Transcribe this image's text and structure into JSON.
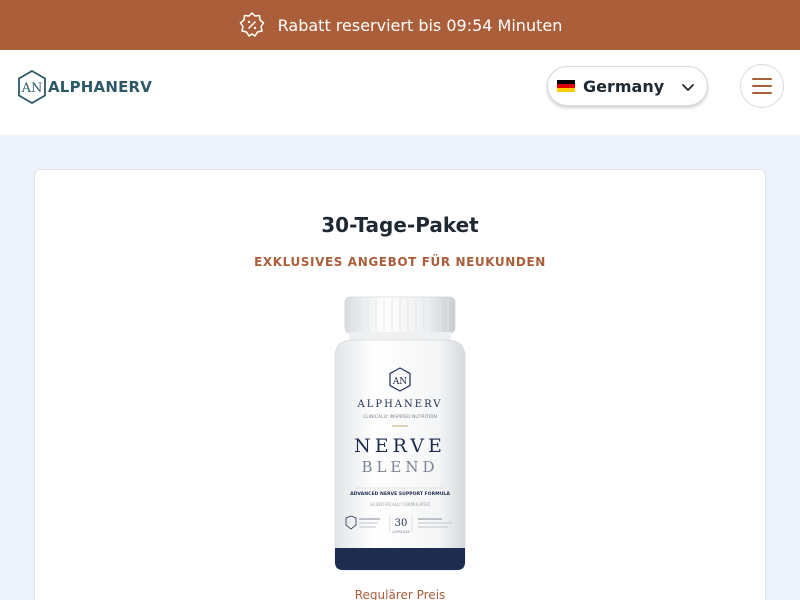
{
  "promo": {
    "text": "Rabatt reserviert bis 09:54 Minuten",
    "icon": "discount-badge-icon",
    "background": "#aa5e3a"
  },
  "header": {
    "logo_text": "ALPHANERV",
    "logo_mark": "AN",
    "country": {
      "label": "Germany",
      "flag": "germany-flag-icon"
    },
    "menu_icon": "hamburger-menu-icon"
  },
  "card": {
    "title": "30-Tage-Paket",
    "offer": "EXKLUSIVES ANGEBOT FÜR NEUKUNDEN",
    "product": {
      "brand_mark": "AN",
      "brand": "ALPHANERV",
      "tagline": "CLINICALLY INSPIRED NUTRITION",
      "name_line1": "NERVE",
      "name_line2": "BLEND",
      "formula": "ADVANCED NERVE SUPPORT FORMULA",
      "sub": "SCIENTIFICALLY FORMULATED",
      "count": "30",
      "count_label": "CAPSULES"
    },
    "regular_price_label": "Regulärer Preis"
  },
  "colors": {
    "accent": "#aa5e3a",
    "page_bg": "#eef3fb",
    "text_dark": "#1f2933",
    "logo": "#2d5a66"
  }
}
